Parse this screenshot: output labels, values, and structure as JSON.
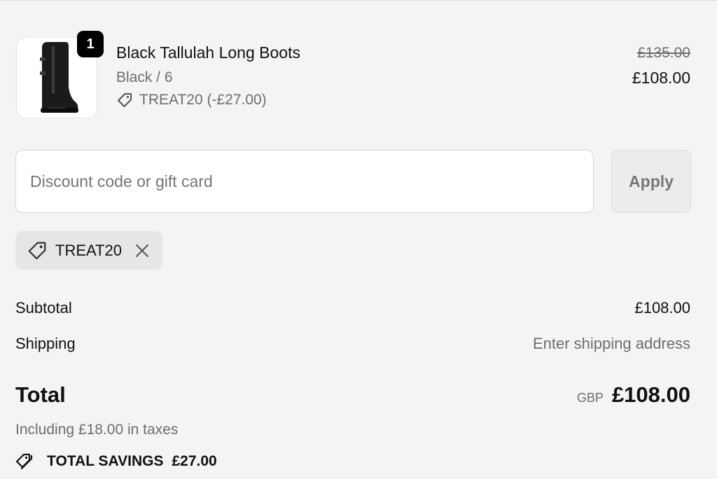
{
  "product": {
    "quantity": "1",
    "title": "Black Tallulah Long Boots",
    "variant": "Black / 6",
    "discount_line": "TREAT20 (-£27.00)",
    "price_original": "£135.00",
    "price_current": "£108.00",
    "image_icon": "black-long-boot"
  },
  "discount_form": {
    "placeholder": "Discount code or gift card",
    "value": "",
    "apply_label": "Apply"
  },
  "applied_code": {
    "code": "TREAT20",
    "tag_icon": "tag-icon",
    "remove_icon": "close-icon"
  },
  "summary": {
    "subtotal_label": "Subtotal",
    "subtotal_value": "£108.00",
    "shipping_label": "Shipping",
    "shipping_value": "Enter shipping address",
    "total_label": "Total",
    "total_currency": "GBP",
    "total_value": "£108.00",
    "tax_note": "Including £18.00 in taxes",
    "savings_label": "TOTAL SAVINGS",
    "savings_value": "£27.00"
  },
  "colors": {
    "background": "#f4f4f4",
    "text": "#111111",
    "muted_text": "#6e6e6e",
    "badge": "#000000"
  }
}
